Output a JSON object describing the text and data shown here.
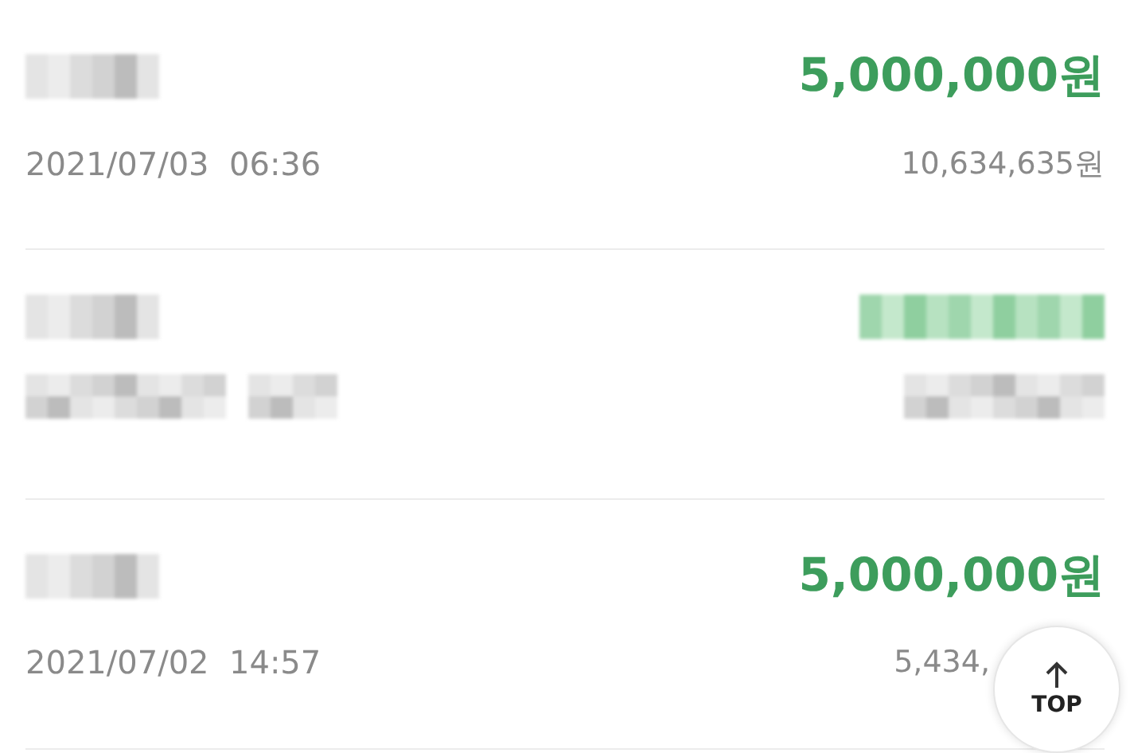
{
  "transactions": [
    {
      "kind": "plain",
      "name_hidden": true,
      "amount": "5,000,000원",
      "date": "2021/07/03",
      "time": "06:36",
      "balance": "10,634,635원"
    },
    {
      "kind": "pixelated"
    },
    {
      "kind": "plain",
      "name_hidden": true,
      "amount": "5,000,000원",
      "date": "2021/07/02",
      "time": "14:57",
      "balance": "5,434,"
    }
  ],
  "top_button": {
    "label": "TOP"
  }
}
